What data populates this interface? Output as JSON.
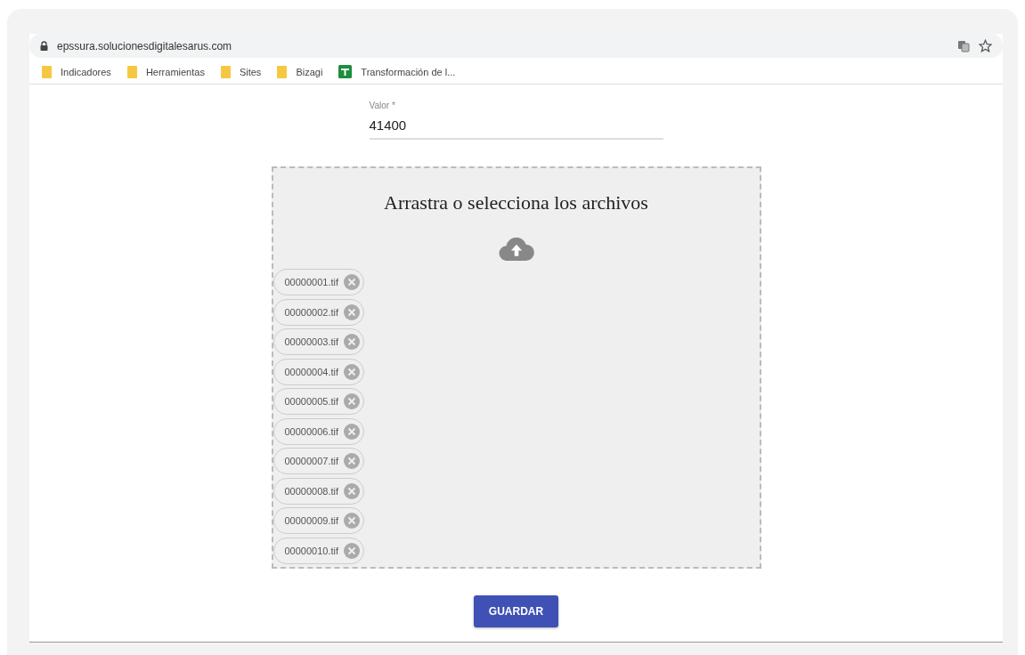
{
  "browser": {
    "url": "epssura.solucionesdigitalesarus.com"
  },
  "bookmarks": [
    {
      "label": "Indicadores",
      "kind": "folder"
    },
    {
      "label": "Herramientas",
      "kind": "folder"
    },
    {
      "label": "Sites",
      "kind": "folder"
    },
    {
      "label": "Bizagi",
      "kind": "folder"
    },
    {
      "label": "Transformación de l...",
      "kind": "sheet"
    }
  ],
  "form": {
    "field": {
      "label": "Valor *",
      "value": "41400"
    },
    "dropzone": {
      "title": "Arrastra o selecciona los archivos",
      "files": [
        "00000001.tif",
        "00000002.tif",
        "00000003.tif",
        "00000004.tif",
        "00000005.tif",
        "00000006.tif",
        "00000007.tif",
        "00000008.tif",
        "00000009.tif",
        "00000010.tif"
      ]
    },
    "button": "GUARDAR"
  }
}
